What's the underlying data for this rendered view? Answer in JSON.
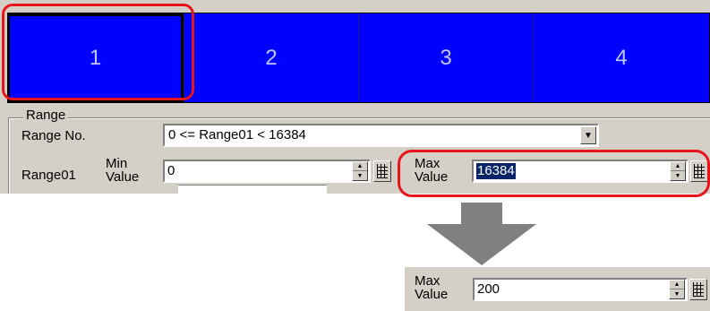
{
  "segments": [
    {
      "label": "1",
      "selected": true
    },
    {
      "label": "2",
      "selected": false
    },
    {
      "label": "3",
      "selected": false
    },
    {
      "label": "4",
      "selected": false
    }
  ],
  "range_group": {
    "title": "Range",
    "range_no_label": "Range No.",
    "range_no_value": "0 <= Range01 < 16384",
    "range_row_label": "Range01",
    "min_label": "Min\nValue",
    "min_value": "0",
    "max_label": "Max\nValue",
    "max_value": "16384"
  },
  "result": {
    "max_label": "Max\nValue",
    "max_value": "200"
  },
  "colors": {
    "segment_fill": "#0000ff",
    "highlight": "#e8141c",
    "arrow": "#808080",
    "dialog_bg": "#d4d0c8",
    "selection_bg": "#0a246a"
  },
  "icons": {
    "dropdown": "chevron-down-icon",
    "spinner_up": "triangle-up-icon",
    "spinner_down": "triangle-down-icon",
    "keypad": "keypad-icon",
    "arrow": "arrow-down-icon"
  }
}
